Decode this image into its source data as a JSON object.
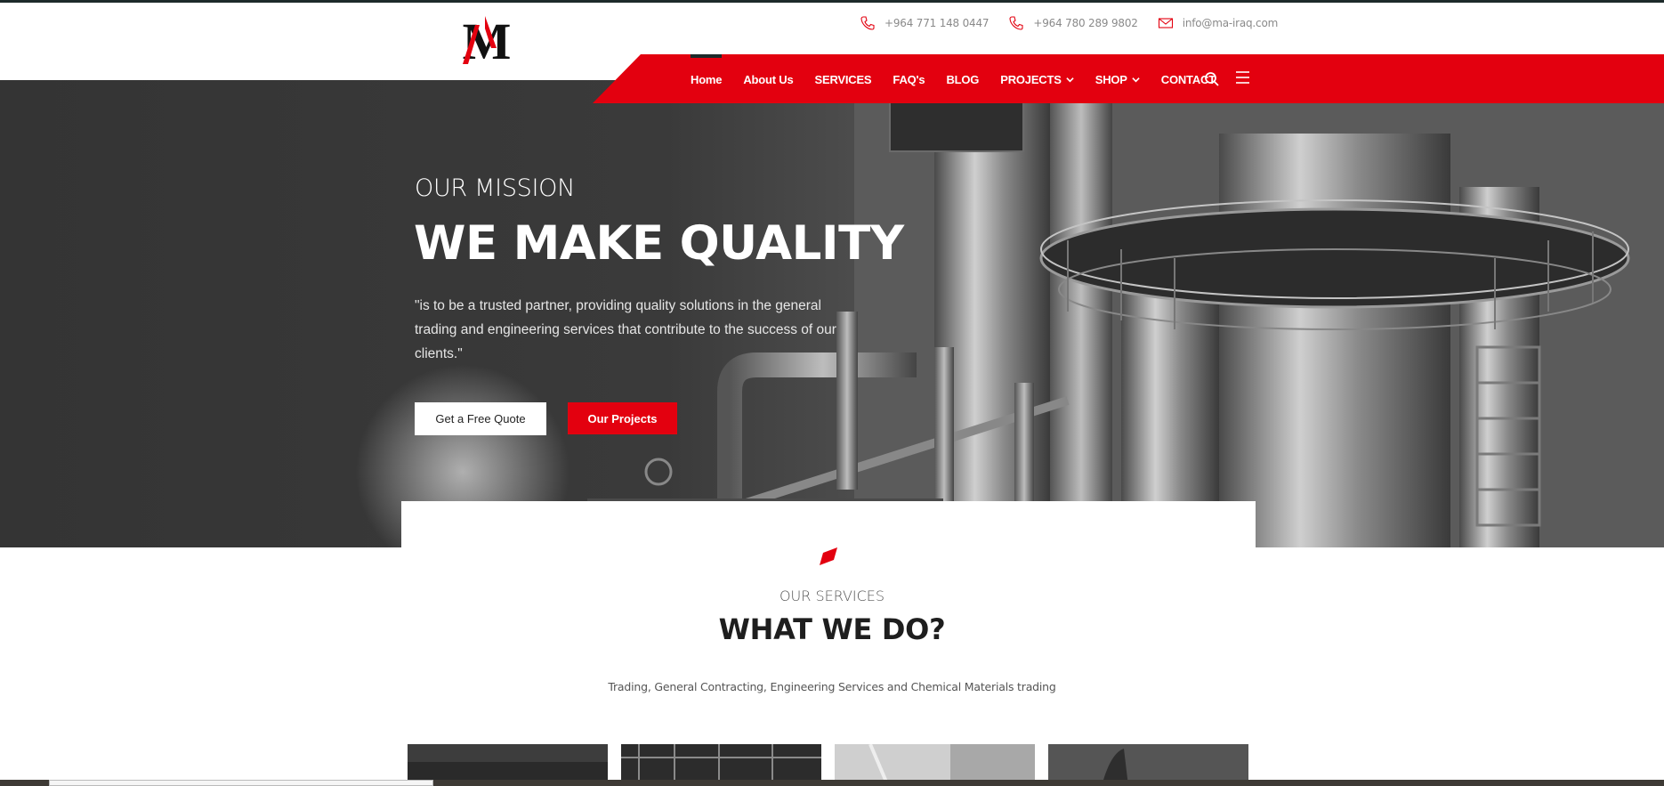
{
  "header": {
    "logo_text": "MA",
    "contacts": [
      {
        "icon": "phone-icon",
        "text": "+964 771 148 0447"
      },
      {
        "icon": "phone-icon",
        "text": "+964 780 289 9802"
      },
      {
        "icon": "mail-icon",
        "text": "info@ma-iraq.com"
      }
    ]
  },
  "nav": {
    "items": [
      {
        "label": "Home",
        "active": true
      },
      {
        "label": "About Us"
      },
      {
        "label": "SERVICES"
      },
      {
        "label": "FAQ's"
      },
      {
        "label": "BLOG"
      },
      {
        "label": "PROJECTS",
        "dropdown": true
      },
      {
        "label": "SHOP",
        "dropdown": true
      },
      {
        "label": "CONTACT"
      }
    ]
  },
  "hero": {
    "subtitle": "OUR MISSION",
    "title": "WE MAKE QUALITY",
    "text": "\"is to be a trusted partner, providing quality solutions in the general trading and engineering services that contribute to the success of our clients.\"",
    "quote_button": "Get a Free Quote",
    "projects_button": "Our Projects"
  },
  "services": {
    "subtitle": "OUR SERVICES",
    "title": "WHAT WE DO?",
    "description": "Trading, General Contracting, Engineering Services and Chemical Materials trading"
  },
  "colors": {
    "accent": "#e3000f",
    "dark": "#1d2a2a"
  }
}
